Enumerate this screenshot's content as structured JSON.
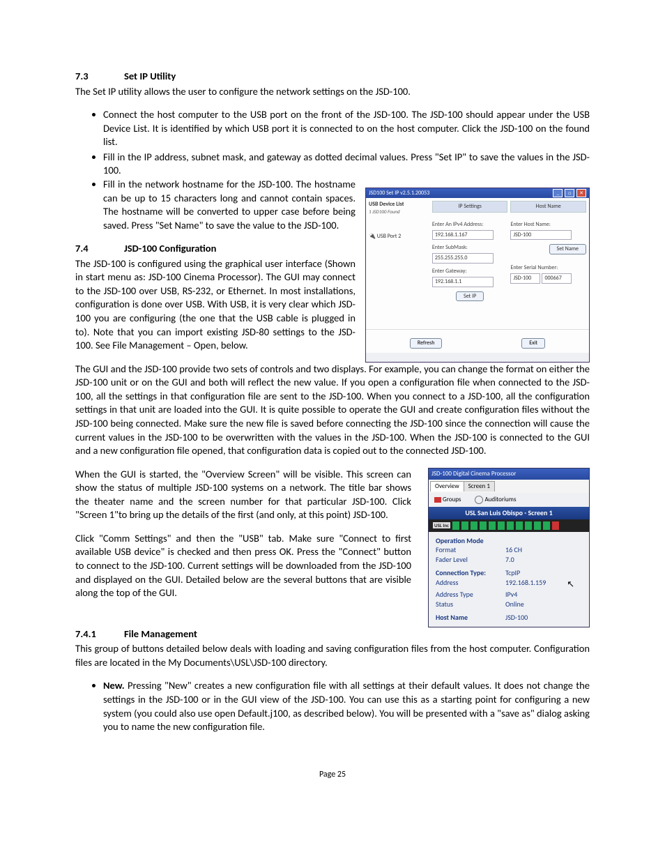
{
  "sec73": {
    "num": "7.3",
    "title": "Set IP Utility",
    "intro": "The Set IP utility allows the user to configure the network settings on the JSD-100.",
    "bullets": [
      "Connect the host computer to the USB port on the front of the JSD-100.  The JSD-100 should appear under the USB Device List.  It is identified by which USB port it is connected to on the host computer. Click the JSD-100 on the found list.",
      "Fill in the IP address, subnet mask, and gateway as dotted decimal values.  Press \"Set IP\" to save the values in the JSD-100.",
      "Fill in the network hostname for the JSD-100.  The hostname can be up to 15 characters long and cannot contain spaces. The hostname will be converted to upper case before being saved.  Press \"Set Name\" to save the value to the JSD-100."
    ]
  },
  "sec74": {
    "num": "7.4",
    "title": "JSD-100 Configuration",
    "para1": "The JSD-100 is configured using the graphical user interface (Shown in start menu as:  JSD-100 Cinema Processor).  The GUI may connect to the JSD-100 over USB, RS-232, or Ethernet.  In most installations, configuration is done over USB.  With USB, it is very clear which JSD-100 you are configuring (the one that the USB cable is plugged in to).  Note that you can import existing JSD-80 settings to the JSD-100.   See File Management – Open, below.",
    "para2": "The GUI and the JSD-100 provide two sets of controls and two displays. For example, you can change the format on either the JSD-100 unit or on the GUI and both will reflect the new value.  If you open a configuration file when connected to the JSD-100, all the settings in that configuration file are sent to the JSD-100.  When you connect to a JSD-100, all the configuration settings in that unit are loaded into the GUI.  It is quite possible to operate the GUI and create configuration files without the JSD-100 being connected.  Make sure the new file is saved before connecting the JSD-100 since the connection will cause the current values in the JSD-100 to be overwritten with the values in the JSD-100. When the JSD-100 is connected to the GUI and a new configuration file opened, that configuration data is copied out to the connected JSD-100.",
    "para3": "When the GUI is started, the \"Overview Screen\" will be visible. This screen can show the status of multiple JSD-100 systems on a network.  The title bar shows the theater name and the screen number for that particular JSD-100. Click \"Screen 1\"to bring up the details of the first (and only, at this point) JSD-100.",
    "para4": "Click \"Comm Settings\" and then the \"USB\" tab.  Make sure \"Connect to first available USB device\" is checked and then press OK. Press the \"Connect\" button to connect to the JSD-100.  Current settings will be downloaded from the JSD-100 and displayed on the GUI.  Detailed below are the several buttons that are visible along the top of the GUI."
  },
  "sec741": {
    "num": "7.4.1",
    "title": "File Management",
    "intro": "This group of buttons detailed below deals with loading and saving configuration files from the host computer. Configuration files are located in the My Documents\\USL\\JSD-100 directory.",
    "newItem": {
      "label": "New.",
      "text": "  Pressing \"New\" creates a new configuration file with all settings at their default values. It does not change the settings in the JSD-100 or in the GUI view of the JSD-100. You can use this as a starting point for configuring a new system (you could also use open Default.j100, as described below).  You will be presented with a \"save as\" dialog asking you to name the new configuration file."
    }
  },
  "setip": {
    "title": "JSD100 Set IP v2.5.1.20053",
    "deviceListHdr": "USB Device List",
    "deviceListSub": "1 JSD100 Found",
    "usbPort": "USB Port 2",
    "colIP": "IP Settings",
    "colHost": "Host Name",
    "lblIPv4": "Enter An IPv4 Address:",
    "valIP": "192.168.1.167",
    "lblSubMask": "Enter SubMask:",
    "valSubMask": "255.255.255.0",
    "lblGateway": "Enter Gateway:",
    "valGateway": "192.168.1.1",
    "btnSetIP": "Set IP",
    "lblHostName": "Enter Host Name:",
    "valHostName": "JSD-100",
    "btnSetName": "Set Name",
    "lblSerial": "Enter Serial Number:",
    "valSerial1": "JSD-100",
    "valSerial2": "000667",
    "btnRefresh": "Refresh",
    "btnExit": "Exit"
  },
  "overview": {
    "title": "JSD-100 Digital Cinema Processor",
    "tabOverview": "Overview",
    "tabScreen1": "Screen 1",
    "toolGroups": "Groups",
    "toolAuditoriums": "Auditoriums",
    "banner": "USL San Luis Obispo - Screen 1",
    "uslBadge": "USL Inc",
    "opModeHdr": "Operation Mode",
    "formatLabel": "Format",
    "formatVal": "16 CH",
    "faderLabel": "Fader Level",
    "faderVal": "7.0",
    "connTypeLabel": "Connection Type:",
    "connTypeVal": "TcpIP",
    "addrLabel": "Address",
    "addrVal": "192.168.1.159",
    "addrTypeLabel": "Address Type",
    "addrTypeVal": "IPv4",
    "statusLabel": "Status",
    "statusVal": "Online",
    "hostLabel": "Host Name",
    "hostVal": "JSD-100"
  },
  "pageNum": "Page 25"
}
